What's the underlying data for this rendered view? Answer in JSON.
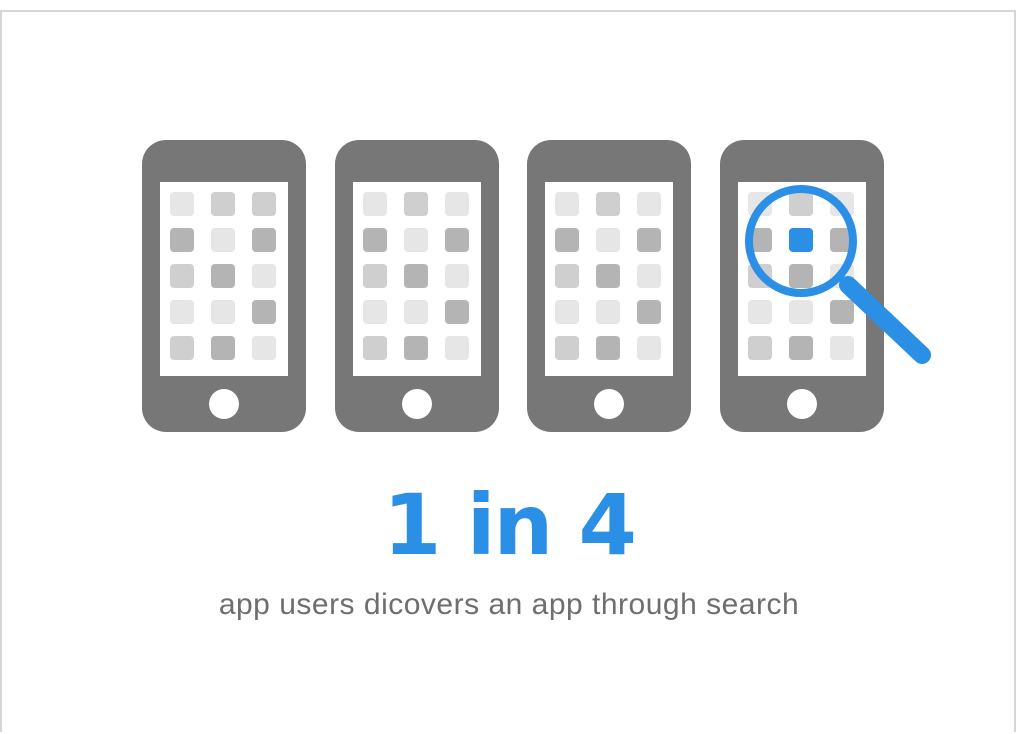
{
  "stat": {
    "headline": "1 in 4",
    "caption": "app users dicovers an app through search"
  },
  "illustration": {
    "phones": [
      {
        "name": "phone-1"
      },
      {
        "name": "phone-2"
      },
      {
        "name": "phone-3"
      },
      {
        "name": "phone-4-with-search"
      }
    ],
    "icons": [
      "phone-icon",
      "app-grid-icon",
      "magnifying-glass-icon"
    ]
  },
  "colors": {
    "accent": "#2b8fe6",
    "phone_body": "#777777",
    "screen": "#ffffff",
    "app_dark": "#b4b4b4",
    "app_mid": "#cfcfcf",
    "app_light": "#e6e6e6",
    "caption": "#6e6e6e",
    "frame_border": "#d6d6d6"
  }
}
